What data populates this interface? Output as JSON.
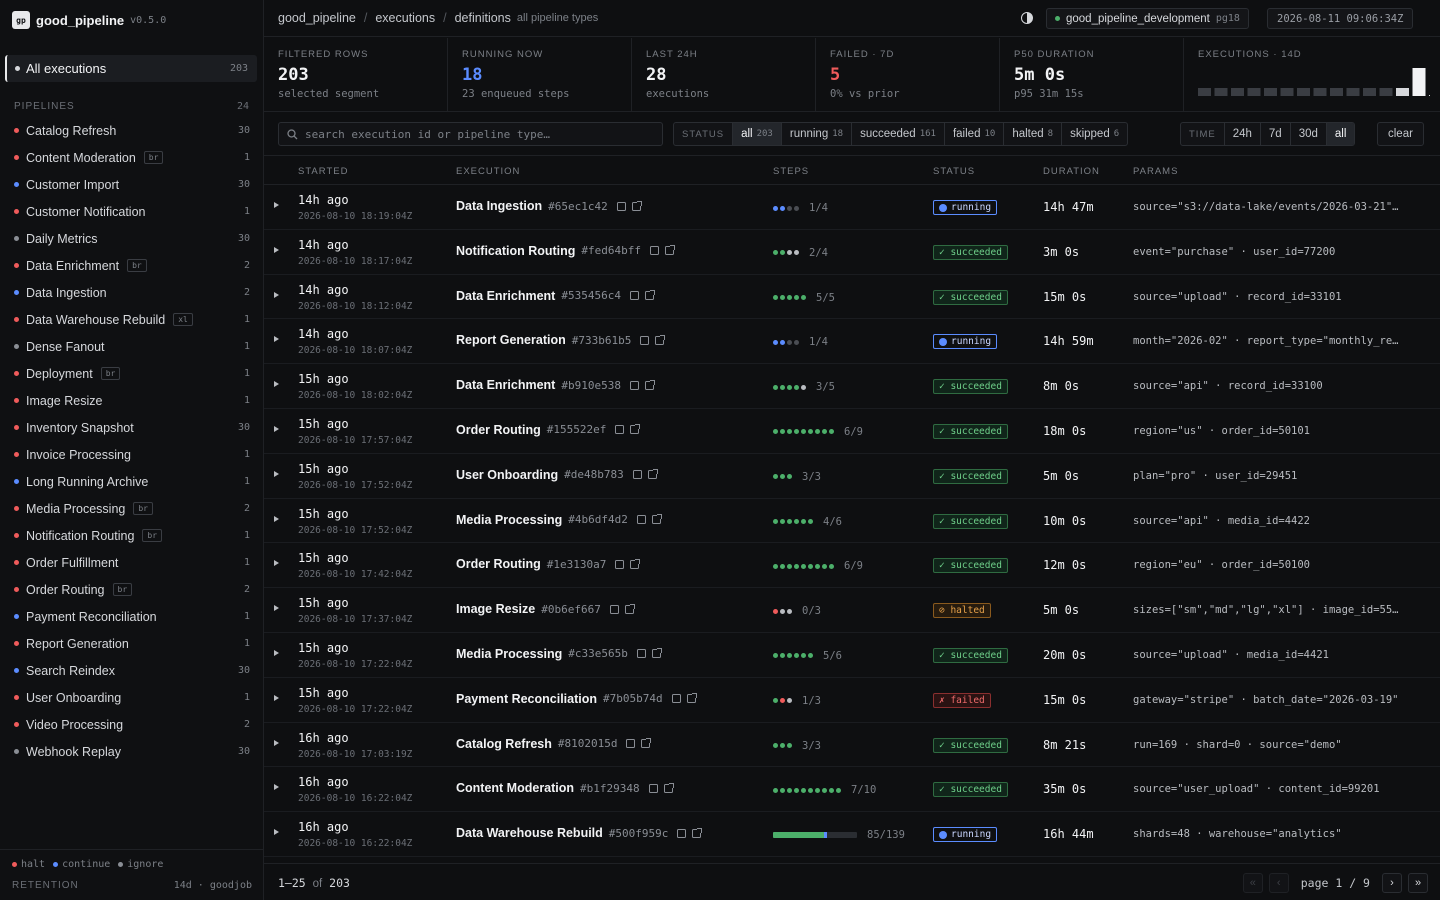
{
  "app": {
    "logo": "gp",
    "name": "good_pipeline",
    "version": "v0.5.0"
  },
  "sidebar": {
    "all_label": "All executions",
    "all_count": "203",
    "pipelines_label": "PIPELINES",
    "pipelines_count": "24",
    "pipelines": [
      {
        "name": "Catalog Refresh",
        "count": "30",
        "color": "#ef5b5b",
        "tag": ""
      },
      {
        "name": "Content Moderation",
        "count": "1",
        "color": "#ef5b5b",
        "tag": "br"
      },
      {
        "name": "Customer Import",
        "count": "30",
        "color": "#5b8cff",
        "tag": ""
      },
      {
        "name": "Customer Notification",
        "count": "1",
        "color": "#ef5b5b",
        "tag": ""
      },
      {
        "name": "Daily Metrics",
        "count": "30",
        "color": "#8a8e95",
        "tag": ""
      },
      {
        "name": "Data Enrichment",
        "count": "2",
        "color": "#ef5b5b",
        "tag": "br"
      },
      {
        "name": "Data Ingestion",
        "count": "2",
        "color": "#5b8cff",
        "tag": ""
      },
      {
        "name": "Data Warehouse Rebuild",
        "count": "1",
        "color": "#ef5b5b",
        "tag": "xl"
      },
      {
        "name": "Dense Fanout",
        "count": "1",
        "color": "#8a8e95",
        "tag": ""
      },
      {
        "name": "Deployment",
        "count": "1",
        "color": "#ef5b5b",
        "tag": "br"
      },
      {
        "name": "Image Resize",
        "count": "1",
        "color": "#ef5b5b",
        "tag": ""
      },
      {
        "name": "Inventory Snapshot",
        "count": "30",
        "color": "#ef5b5b",
        "tag": ""
      },
      {
        "name": "Invoice Processing",
        "count": "1",
        "color": "#ef5b5b",
        "tag": ""
      },
      {
        "name": "Long Running Archive",
        "count": "1",
        "color": "#5b8cff",
        "tag": ""
      },
      {
        "name": "Media Processing",
        "count": "2",
        "color": "#ef5b5b",
        "tag": "br"
      },
      {
        "name": "Notification Routing",
        "count": "1",
        "color": "#ef5b5b",
        "tag": "br"
      },
      {
        "name": "Order Fulfillment",
        "count": "1",
        "color": "#ef5b5b",
        "tag": ""
      },
      {
        "name": "Order Routing",
        "count": "2",
        "color": "#ef5b5b",
        "tag": "br"
      },
      {
        "name": "Payment Reconciliation",
        "count": "1",
        "color": "#5b8cff",
        "tag": ""
      },
      {
        "name": "Report Generation",
        "count": "1",
        "color": "#ef5b5b",
        "tag": ""
      },
      {
        "name": "Search Reindex",
        "count": "30",
        "color": "#5b8cff",
        "tag": ""
      },
      {
        "name": "User Onboarding",
        "count": "1",
        "color": "#ef5b5b",
        "tag": ""
      },
      {
        "name": "Video Processing",
        "count": "2",
        "color": "#ef5b5b",
        "tag": ""
      },
      {
        "name": "Webhook Replay",
        "count": "30",
        "color": "#8a8e95",
        "tag": ""
      }
    ],
    "legend": [
      {
        "label": "halt",
        "color": "#ef5b5b"
      },
      {
        "label": "continue",
        "color": "#5b8cff"
      },
      {
        "label": "ignore",
        "color": "#8a8e95"
      }
    ],
    "retention_label": "RETENTION",
    "retention_value": "14d · goodjob"
  },
  "topbar": {
    "crumbs": [
      "good_pipeline",
      "executions",
      "definitions"
    ],
    "crumb_sub": "all pipeline types",
    "theme_icon": "contrast-icon",
    "env_name": "good_pipeline_development",
    "env_db": "pg18",
    "clock": "2026-08-11 09:06:34Z"
  },
  "stats": [
    {
      "label": "FILTERED ROWS",
      "value": "203",
      "sub": "selected segment",
      "tone": ""
    },
    {
      "label": "RUNNING NOW",
      "value": "18",
      "sub": "23 enqueued steps",
      "tone": "blue"
    },
    {
      "label": "LAST 24H",
      "value": "28",
      "sub": "executions",
      "tone": ""
    },
    {
      "label": "FAILED · 7D",
      "value": "5",
      "sub": "0% vs prior",
      "tone": "red"
    },
    {
      "label": "P50 DURATION",
      "value": "5m 0s",
      "sub": "p95 31m 15s",
      "tone": ""
    }
  ],
  "sparkline": {
    "label": "EXECUTIONS · 14D",
    "values": [
      1,
      1,
      1,
      1,
      1,
      1,
      1,
      1,
      1,
      1,
      1,
      1,
      2,
      28,
      0
    ]
  },
  "filters": {
    "search_placeholder": "search execution id or pipeline type…",
    "status_label": "STATUS",
    "status_options": [
      {
        "label": "all",
        "count": "203",
        "active": true
      },
      {
        "label": "running",
        "count": "18",
        "active": false
      },
      {
        "label": "succeeded",
        "count": "161",
        "active": false
      },
      {
        "label": "failed",
        "count": "10",
        "active": false
      },
      {
        "label": "halted",
        "count": "8",
        "active": false
      },
      {
        "label": "skipped",
        "count": "6",
        "active": false
      }
    ],
    "time_label": "TIME",
    "time_options": [
      {
        "label": "24h",
        "active": false
      },
      {
        "label": "7d",
        "active": false
      },
      {
        "label": "30d",
        "active": false
      },
      {
        "label": "all",
        "active": true
      }
    ],
    "clear_label": "clear"
  },
  "table": {
    "columns": [
      "STARTED",
      "EXECUTION",
      "STEPS",
      "STATUS",
      "DURATION",
      "PARAMS"
    ],
    "rows": [
      {
        "ago": "14h ago",
        "ts": "2026-08-10 18:19:04Z",
        "name": "Data Ingestion",
        "id": "#65ec1c42",
        "dots": [
          "#5b8cff",
          "#5b8cff",
          "#4a4d53",
          "#4a4d53"
        ],
        "steps": "1/4",
        "status": "running",
        "duration": "14h 47m",
        "params": "source=\"s3://data-lake/events/2026-03-21\"…"
      },
      {
        "ago": "14h ago",
        "ts": "2026-08-10 18:17:04Z",
        "name": "Notification Routing",
        "id": "#fed64bff",
        "dots": [
          "#4caf6a",
          "#4caf6a",
          "#b9bcc1",
          "#b9bcc1"
        ],
        "steps": "2/4",
        "status": "succeeded",
        "duration": "3m 0s",
        "params": "event=\"purchase\" · user_id=77200"
      },
      {
        "ago": "14h ago",
        "ts": "2026-08-10 18:12:04Z",
        "name": "Data Enrichment",
        "id": "#535456c4",
        "dots": [
          "#4caf6a",
          "#4caf6a",
          "#4caf6a",
          "#4caf6a",
          "#4caf6a"
        ],
        "steps": "5/5",
        "status": "succeeded",
        "duration": "15m 0s",
        "params": "source=\"upload\" · record_id=33101"
      },
      {
        "ago": "14h ago",
        "ts": "2026-08-10 18:07:04Z",
        "name": "Report Generation",
        "id": "#733b61b5",
        "dots": [
          "#5b8cff",
          "#5b8cff",
          "#4a4d53",
          "#4a4d53"
        ],
        "steps": "1/4",
        "status": "running",
        "duration": "14h 59m",
        "params": "month=\"2026-02\" · report_type=\"monthly_re…"
      },
      {
        "ago": "15h ago",
        "ts": "2026-08-10 18:02:04Z",
        "name": "Data Enrichment",
        "id": "#b910e538",
        "dots": [
          "#4caf6a",
          "#4caf6a",
          "#4caf6a",
          "#4caf6a",
          "#b9bcc1"
        ],
        "steps": "3/5",
        "status": "succeeded",
        "duration": "8m 0s",
        "params": "source=\"api\" · record_id=33100"
      },
      {
        "ago": "15h ago",
        "ts": "2026-08-10 17:57:04Z",
        "name": "Order Routing",
        "id": "#155522ef",
        "dots": [
          "#4caf6a",
          "#4caf6a",
          "#4caf6a",
          "#4caf6a",
          "#4caf6a",
          "#4caf6a",
          "#4caf6a",
          "#4caf6a",
          "#4caf6a"
        ],
        "steps": "6/9",
        "status": "succeeded",
        "duration": "18m 0s",
        "params": "region=\"us\" · order_id=50101"
      },
      {
        "ago": "15h ago",
        "ts": "2026-08-10 17:52:04Z",
        "name": "User Onboarding",
        "id": "#de48b783",
        "dots": [
          "#4caf6a",
          "#4caf6a",
          "#4caf6a"
        ],
        "steps": "3/3",
        "status": "succeeded",
        "duration": "5m 0s",
        "params": "plan=\"pro\" · user_id=29451"
      },
      {
        "ago": "15h ago",
        "ts": "2026-08-10 17:52:04Z",
        "name": "Media Processing",
        "id": "#4b6df4d2",
        "dots": [
          "#4caf6a",
          "#4caf6a",
          "#4caf6a",
          "#4caf6a",
          "#4caf6a",
          "#4caf6a"
        ],
        "steps": "4/6",
        "status": "succeeded",
        "duration": "10m 0s",
        "params": "source=\"api\" · media_id=4422"
      },
      {
        "ago": "15h ago",
        "ts": "2026-08-10 17:42:04Z",
        "name": "Order Routing",
        "id": "#1e3130a7",
        "dots": [
          "#4caf6a",
          "#4caf6a",
          "#4caf6a",
          "#4caf6a",
          "#4caf6a",
          "#4caf6a",
          "#4caf6a",
          "#4caf6a",
          "#4caf6a"
        ],
        "steps": "6/9",
        "status": "succeeded",
        "duration": "12m 0s",
        "params": "region=\"eu\" · order_id=50100"
      },
      {
        "ago": "15h ago",
        "ts": "2026-08-10 17:37:04Z",
        "name": "Image Resize",
        "id": "#0b6ef667",
        "dots": [
          "#ef5b5b",
          "#b9bcc1",
          "#b9bcc1"
        ],
        "steps": "0/3",
        "status": "halted",
        "duration": "5m 0s",
        "params": "sizes=[\"sm\",\"md\",\"lg\",\"xl\"] · image_id=55…"
      },
      {
        "ago": "15h ago",
        "ts": "2026-08-10 17:22:04Z",
        "name": "Media Processing",
        "id": "#c33e565b",
        "dots": [
          "#4caf6a",
          "#4caf6a",
          "#4caf6a",
          "#4caf6a",
          "#4caf6a",
          "#4caf6a"
        ],
        "steps": "5/6",
        "status": "succeeded",
        "duration": "20m 0s",
        "params": "source=\"upload\" · media_id=4421"
      },
      {
        "ago": "15h ago",
        "ts": "2026-08-10 17:22:04Z",
        "name": "Payment Reconciliation",
        "id": "#7b05b74d",
        "dots": [
          "#4caf6a",
          "#ef5b5b",
          "#b9bcc1"
        ],
        "steps": "1/3",
        "status": "failed",
        "duration": "15m 0s",
        "params": "gateway=\"stripe\" · batch_date=\"2026-03-19\""
      },
      {
        "ago": "16h ago",
        "ts": "2026-08-10 17:03:19Z",
        "name": "Catalog Refresh",
        "id": "#8102015d",
        "dots": [
          "#4caf6a",
          "#4caf6a",
          "#4caf6a"
        ],
        "steps": "3/3",
        "status": "succeeded",
        "duration": "8m 21s",
        "params": "run=169 · shard=0 · source=\"demo\""
      },
      {
        "ago": "16h ago",
        "ts": "2026-08-10 16:22:04Z",
        "name": "Content Moderation",
        "id": "#b1f29348",
        "dots": [
          "#4caf6a",
          "#4caf6a",
          "#4caf6a",
          "#4caf6a",
          "#4caf6a",
          "#4caf6a",
          "#4caf6a",
          "#4caf6a",
          "#4caf6a",
          "#4caf6a"
        ],
        "steps": "7/10",
        "status": "succeeded",
        "duration": "35m 0s",
        "params": "source=\"user_upload\" · content_id=99201"
      },
      {
        "ago": "16h ago",
        "ts": "2026-08-10 16:22:04Z",
        "name": "Data Warehouse Rebuild",
        "id": "#500f959c",
        "progress": 0.61,
        "steps": "85/139",
        "status": "running",
        "duration": "16h 44m",
        "params": "shards=48 · warehouse=\"analytics\""
      }
    ],
    "status_labels": {
      "running": "running",
      "succeeded": "✓ succeeded",
      "halted": "⊘ halted",
      "failed": "✗ failed"
    }
  },
  "footer": {
    "range_a": "1–25",
    "range_of": "of",
    "range_total": "203",
    "page": "page 1 / 9",
    "first": "«",
    "prev": "‹",
    "next": "›",
    "last": "»"
  }
}
